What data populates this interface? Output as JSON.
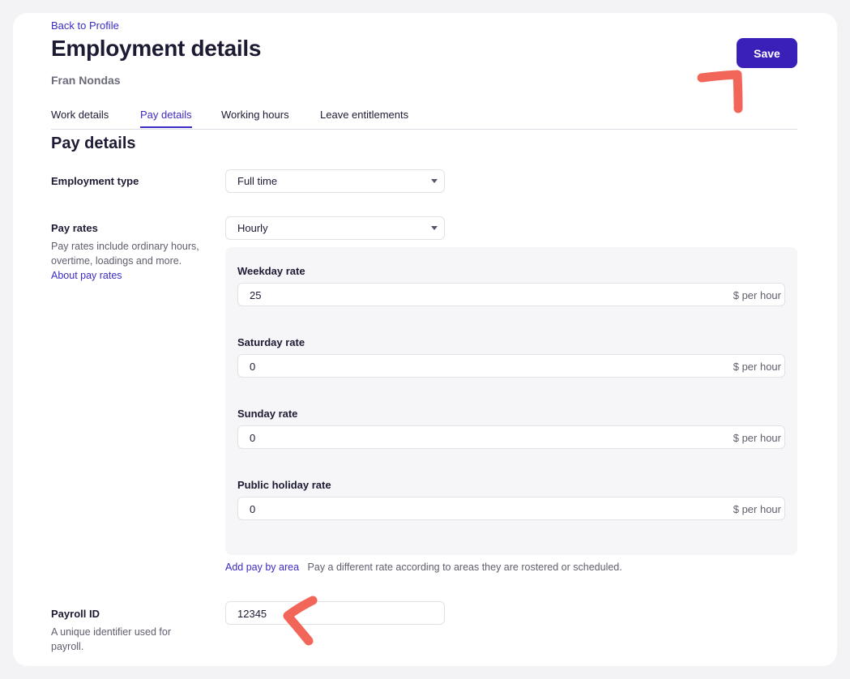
{
  "header": {
    "back_link": "Back to Profile",
    "title": "Employment details",
    "person_name": "Fran Nondas",
    "save_label": "Save"
  },
  "tabs": [
    {
      "label": "Work details",
      "active": false
    },
    {
      "label": "Pay details",
      "active": true
    },
    {
      "label": "Working hours",
      "active": false
    },
    {
      "label": "Leave entitlements",
      "active": false
    }
  ],
  "section": {
    "title": "Pay details"
  },
  "employment_type": {
    "label": "Employment type",
    "value": "Full time"
  },
  "pay_rates": {
    "label": "Pay rates",
    "help_text": "Pay rates include ordinary hours, overtime, loadings and more.",
    "help_link": "About pay rates",
    "type_value": "Hourly",
    "rates": [
      {
        "label": "Weekday rate",
        "value": "25",
        "suffix": "$ per hour"
      },
      {
        "label": "Saturday rate",
        "value": "0",
        "suffix": "$ per hour"
      },
      {
        "label": "Sunday rate",
        "value": "0",
        "suffix": "$ per hour"
      },
      {
        "label": "Public holiday rate",
        "value": "0",
        "suffix": "$ per hour"
      }
    ],
    "add_area_link": "Add pay by area",
    "add_area_text": "Pay a different rate according to areas they are rostered or scheduled."
  },
  "payroll": {
    "label": "Payroll ID",
    "help_text": "A unique identifier used for payroll.",
    "value": "12345"
  },
  "colors": {
    "accent": "#3a1fb8",
    "link": "#3b2bc4",
    "annotation": "#f2665a"
  }
}
